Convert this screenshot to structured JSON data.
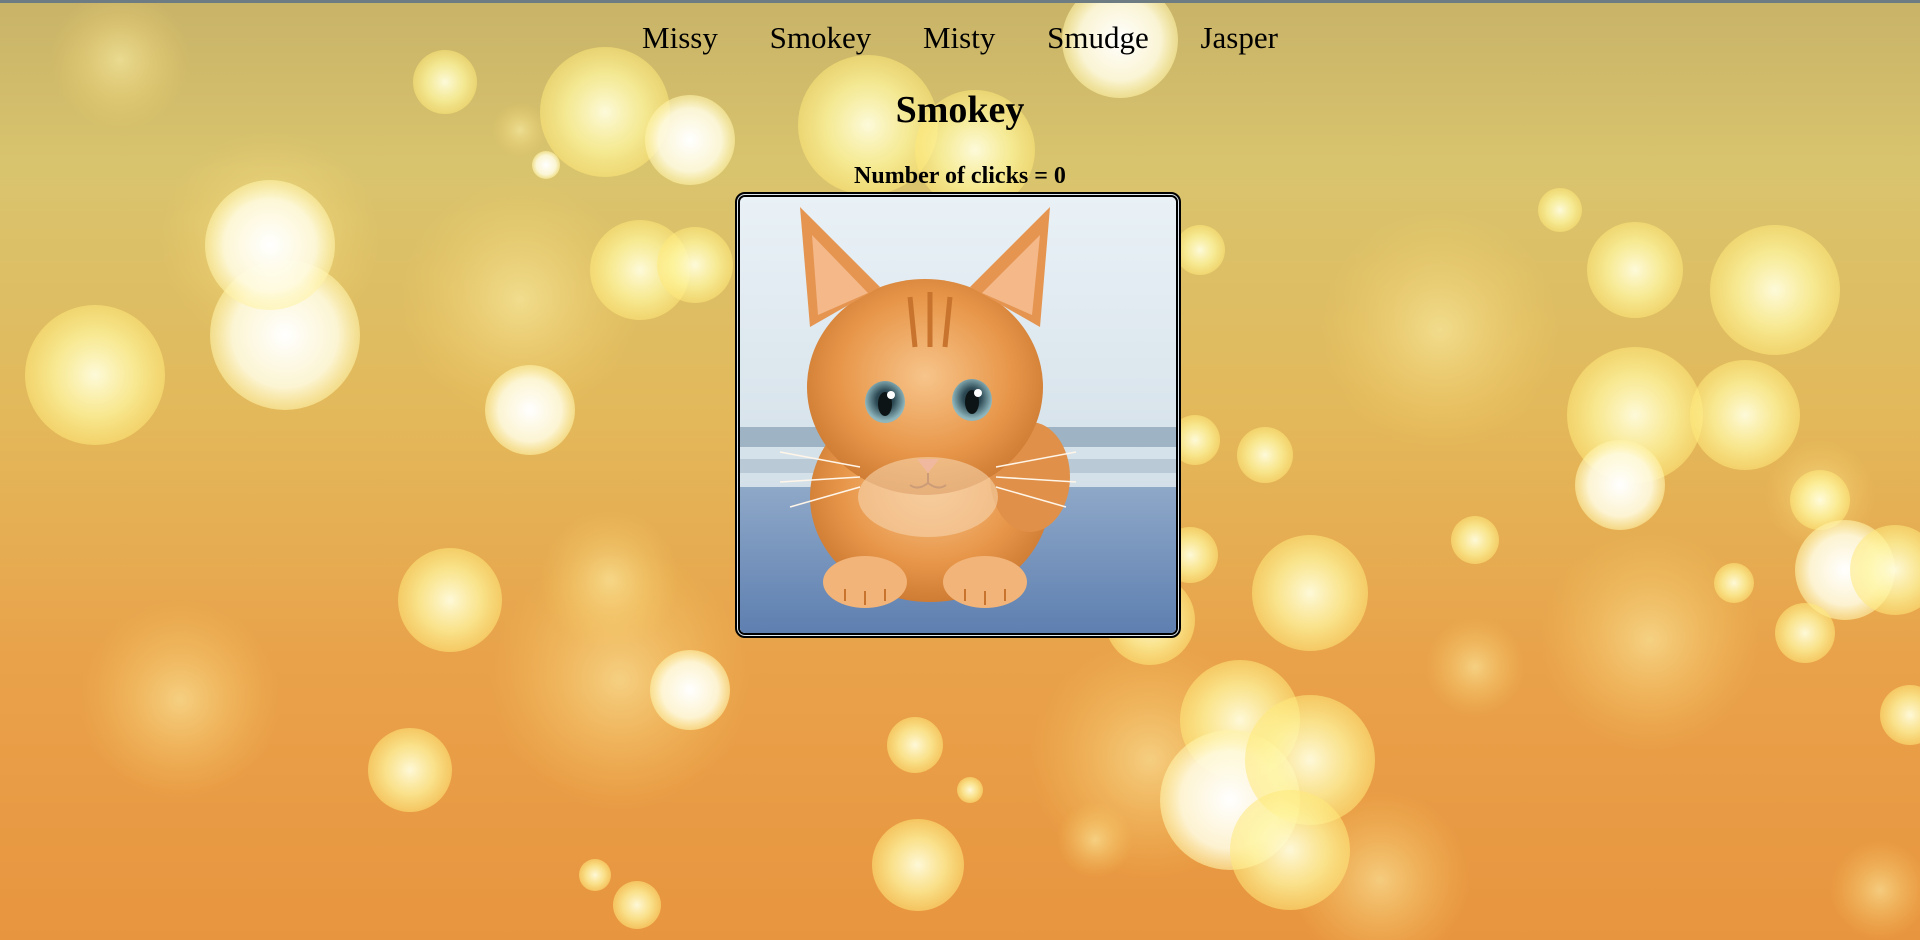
{
  "nav": {
    "items": [
      {
        "label": "Missy"
      },
      {
        "label": "Smokey"
      },
      {
        "label": "Misty"
      },
      {
        "label": "Smudge"
      },
      {
        "label": "Jasper"
      }
    ]
  },
  "cat": {
    "name": "Smokey",
    "clicks_text": "Number of clicks = 0",
    "click_count": 0,
    "image_alt": "Smokey"
  },
  "colors": {
    "background_top": "#c8b368",
    "background_bottom": "#e8953f",
    "bokeh_light": "#fffbb0",
    "text": "#000000"
  }
}
